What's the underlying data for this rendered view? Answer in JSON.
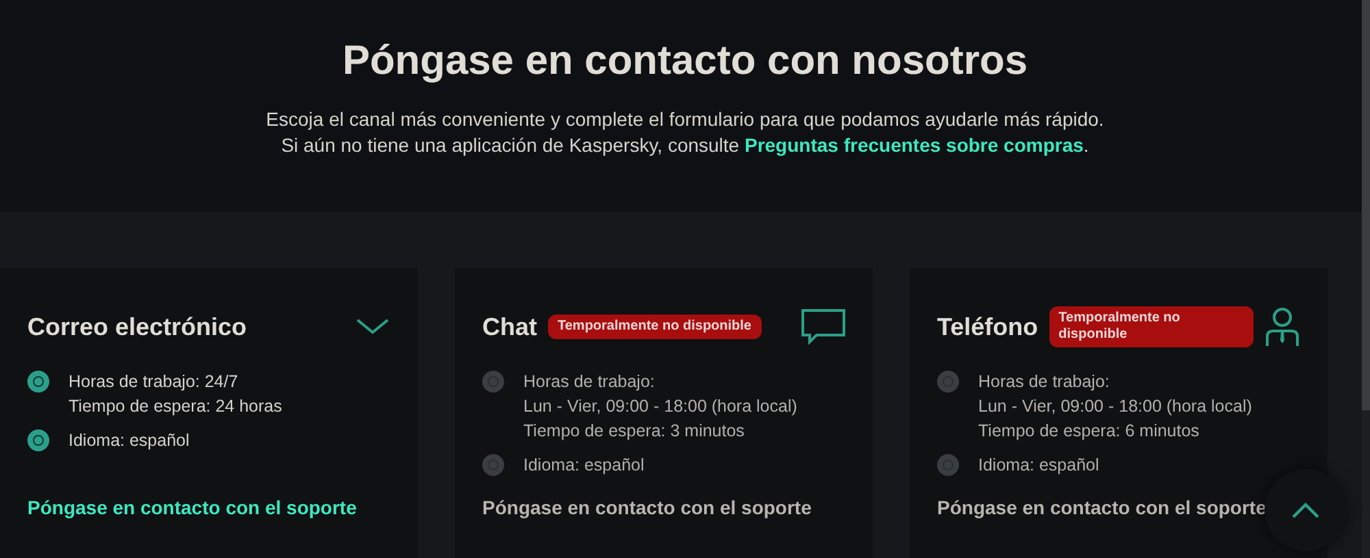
{
  "header": {
    "title": "Póngase en contacto con nosotros",
    "subtitle": "Escoja el canal más conveniente y complete el formulario para que podamos ayudarle más rápido.",
    "faq_prefix": "Si aún no tiene una aplicación de Kaspersky, consulte",
    "faq_link": "Preguntas frecuentes sobre compras",
    "faq_suffix": "."
  },
  "cards": [
    {
      "kind": "email",
      "title": "Correo electrónico",
      "available": true,
      "items": [
        [
          "Horas de trabajo: 24/7",
          "Tiempo de espera: 24 horas"
        ],
        [
          "Idioma: español"
        ]
      ],
      "link": "Póngase en contacto con el soporte"
    },
    {
      "kind": "chat",
      "title": "Chat",
      "available": false,
      "badge": "Temporalmente no disponible",
      "items": [
        [
          "Horas de trabajo:",
          "Lun - Vier, 09:00 - 18:00 (hora local)",
          "Tiempo de espera: 3 minutos"
        ],
        [
          "Idioma: español"
        ]
      ],
      "link": "Póngase en contacto con el soporte"
    },
    {
      "kind": "phone",
      "title": "Teléfono",
      "available": false,
      "badge": "Temporalmente no disponible",
      "items": [
        [
          "Horas de trabajo:",
          "Lun - Vier, 09:00 - 18:00 (hora local)",
          "Tiempo de espera: 6 minutos"
        ],
        [
          "Idioma: español"
        ]
      ],
      "link": "Póngase en contacto con el soporte"
    }
  ]
}
